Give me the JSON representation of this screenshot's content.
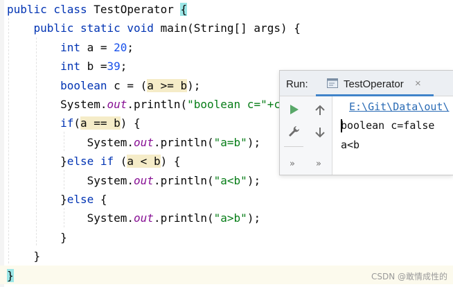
{
  "editor": {
    "lines": [
      {
        "parts": [
          {
            "t": "public class ",
            "c": "kw"
          },
          {
            "t": "TestOperator ",
            "c": ""
          },
          {
            "t": "{",
            "c": "brace-hl"
          }
        ]
      },
      {
        "parts": [
          {
            "t": "    public static void ",
            "c": "kw"
          },
          {
            "t": "main(String[] args) {",
            "c": ""
          }
        ]
      },
      {
        "parts": [
          {
            "t": "        int ",
            "c": "kw"
          },
          {
            "t": "a = ",
            "c": ""
          },
          {
            "t": "20",
            "c": "num"
          },
          {
            "t": ";",
            "c": ""
          }
        ]
      },
      {
        "parts": [
          {
            "t": "        int ",
            "c": "kw"
          },
          {
            "t": "b =",
            "c": ""
          },
          {
            "t": "39",
            "c": "num"
          },
          {
            "t": ";",
            "c": ""
          }
        ]
      },
      {
        "parts": [
          {
            "t": "        boolean ",
            "c": "kw"
          },
          {
            "t": "c = (",
            "c": ""
          },
          {
            "t": "a >= b",
            "c": "hl"
          },
          {
            "t": ");",
            "c": ""
          }
        ]
      },
      {
        "parts": [
          {
            "t": "        System.",
            "c": ""
          },
          {
            "t": "out",
            "c": "fld"
          },
          {
            "t": ".println(",
            "c": ""
          },
          {
            "t": "\"boolean c=\"+c);",
            "c": "str"
          }
        ]
      },
      {
        "parts": [
          {
            "t": "        if",
            "c": "kw"
          },
          {
            "t": "(",
            "c": ""
          },
          {
            "t": "a == b",
            "c": "hl"
          },
          {
            "t": ") {",
            "c": ""
          }
        ]
      },
      {
        "parts": [
          {
            "t": "            System.",
            "c": ""
          },
          {
            "t": "out",
            "c": "fld"
          },
          {
            "t": ".println(",
            "c": ""
          },
          {
            "t": "\"a=b\"",
            "c": "str"
          },
          {
            "t": ");",
            "c": ""
          }
        ]
      },
      {
        "parts": [
          {
            "t": "        }",
            "c": ""
          },
          {
            "t": "else if ",
            "c": "kw"
          },
          {
            "t": "(",
            "c": ""
          },
          {
            "t": "a < b",
            "c": "hl"
          },
          {
            "t": ") {",
            "c": ""
          }
        ]
      },
      {
        "parts": [
          {
            "t": "            System.",
            "c": ""
          },
          {
            "t": "out",
            "c": "fld"
          },
          {
            "t": ".println(",
            "c": ""
          },
          {
            "t": "\"a<b\"",
            "c": "str"
          },
          {
            "t": ");",
            "c": ""
          }
        ]
      },
      {
        "parts": [
          {
            "t": "        }",
            "c": ""
          },
          {
            "t": "else ",
            "c": "kw"
          },
          {
            "t": "{",
            "c": ""
          }
        ]
      },
      {
        "parts": [
          {
            "t": "            System.",
            "c": ""
          },
          {
            "t": "out",
            "c": "fld"
          },
          {
            "t": ".println(",
            "c": ""
          },
          {
            "t": "\"a>b\"",
            "c": "str"
          },
          {
            "t": ");",
            "c": ""
          }
        ]
      },
      {
        "parts": [
          {
            "t": "        }",
            "c": ""
          }
        ]
      },
      {
        "parts": [
          {
            "t": "    }",
            "c": ""
          }
        ]
      },
      {
        "parts": [
          {
            "t": "}",
            "c": "brace-hl"
          }
        ]
      }
    ]
  },
  "run_panel": {
    "title": "Run:",
    "tab_label": "TestOperator",
    "tab_close": "×",
    "more_glyph": "»",
    "console_path": "E:\\Git\\Data\\out\\",
    "output_lines": [
      "boolean c=false",
      "a<b"
    ]
  },
  "watermark": "CSDN @敢情成性的",
  "colors": {
    "keyword": "#0033b3",
    "number": "#1750eb",
    "string": "#067d17",
    "field": "#871094",
    "run_icon": "#59a869",
    "tab_underline": "#4083c9"
  }
}
